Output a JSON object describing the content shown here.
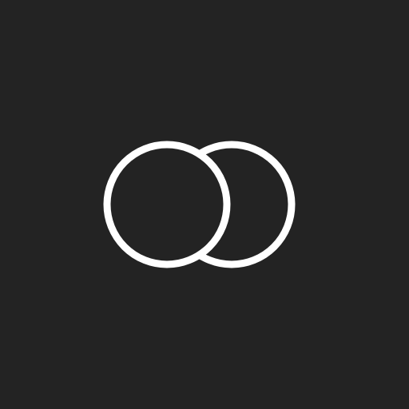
{
  "icon": {
    "name": "overlapping-circles-icon",
    "stroke_color": "#ffffff",
    "background_color": "#232323"
  }
}
